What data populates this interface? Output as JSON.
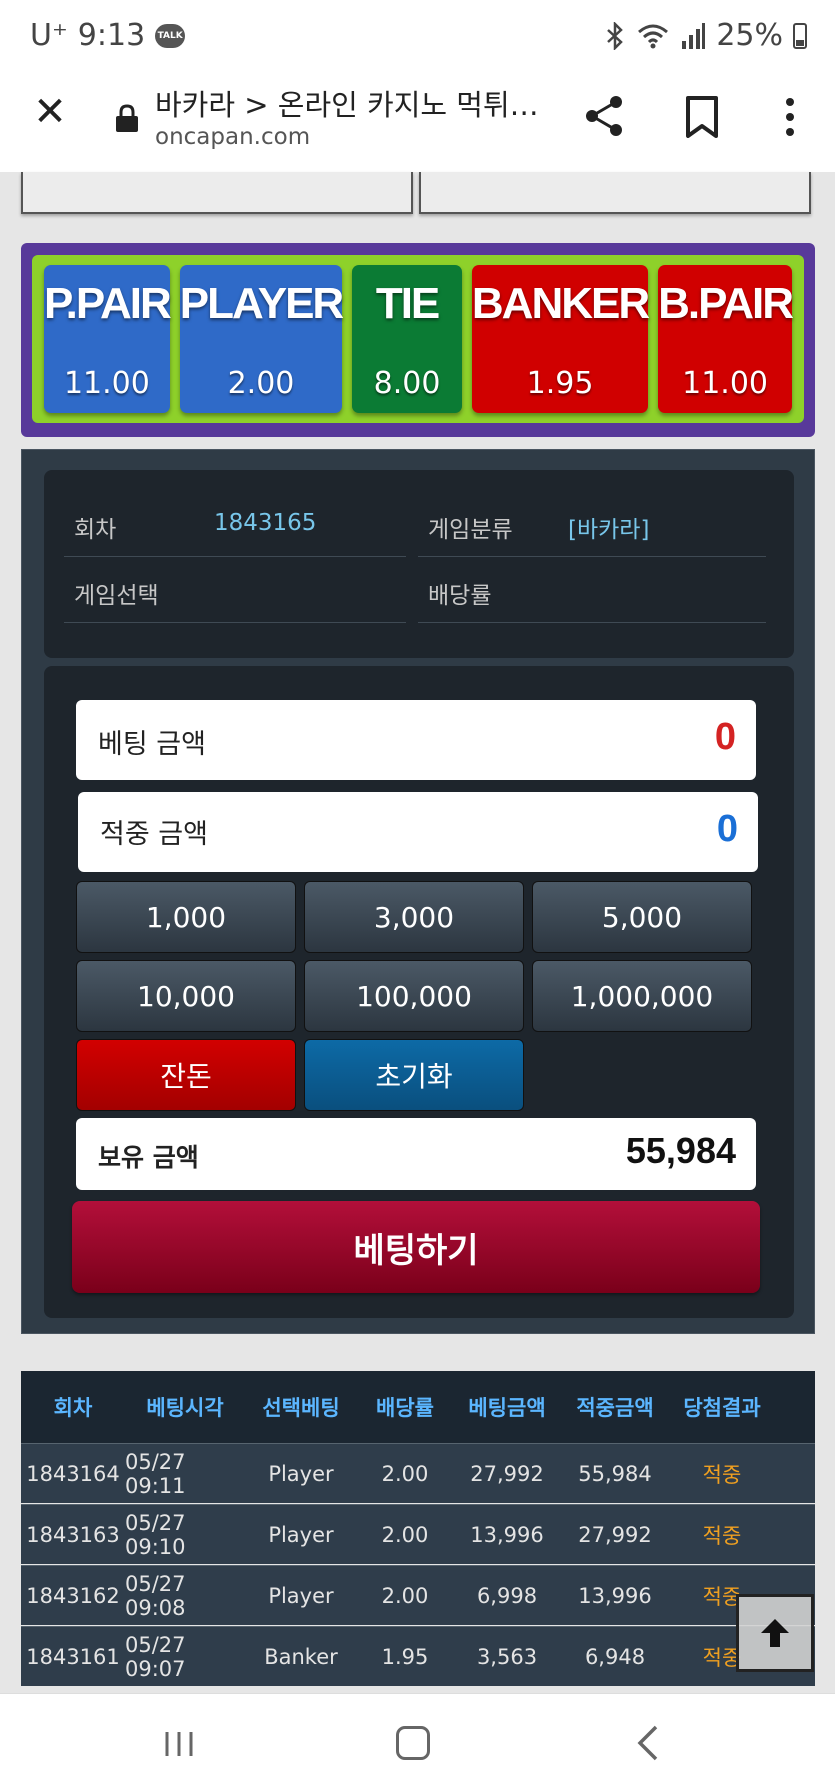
{
  "status_bar": {
    "carrier": "U⁺",
    "time": "9:13",
    "talk_badge": "TALK",
    "battery": "25%"
  },
  "browser": {
    "title": "바카라 > 온라인 카지노 먹튀…",
    "domain": "oncapan.com"
  },
  "odds": [
    {
      "name": "P.PAIR",
      "value": "11.00",
      "color": "#2f6ac8"
    },
    {
      "name": "PLAYER",
      "value": "2.00",
      "color": "#2f6ac8"
    },
    {
      "name": "TIE",
      "value": "8.00",
      "color": "#0b7b34"
    },
    {
      "name": "BANKER",
      "value": "1.95",
      "color": "#d00000"
    },
    {
      "name": "B.PAIR",
      "value": "11.00",
      "color": "#d00000"
    }
  ],
  "info": {
    "round_label": "회차",
    "round_value": "1843165",
    "category_label": "게임분류",
    "category_value": "[바카라]",
    "selection_label": "게임선택",
    "rate_label": "배당률"
  },
  "bet": {
    "bet_amount_label": "베팅 금액",
    "bet_amount_value": "0",
    "win_amount_label": "적중 금액",
    "win_amount_value": "0",
    "amount_buttons": [
      "1,000",
      "3,000",
      "5,000",
      "10,000",
      "100,000",
      "1,000,000"
    ],
    "remainder_label": "잔돈",
    "reset_label": "초기화",
    "balance_label": "보유 금액",
    "balance_value": "55,984",
    "submit_label": "베팅하기"
  },
  "history": {
    "headers": [
      "회차",
      "베팅시각",
      "선택베팅",
      "배당률",
      "베팅금액",
      "적중금액",
      "당첨결과"
    ],
    "rows": [
      [
        "1843164",
        "05/27 09:11",
        "Player",
        "2.00",
        "27,992",
        "55,984",
        "적중"
      ],
      [
        "1843163",
        "05/27 09:10",
        "Player",
        "2.00",
        "13,996",
        "27,992",
        "적중"
      ],
      [
        "1843162",
        "05/27 09:08",
        "Player",
        "2.00",
        "6,998",
        "13,996",
        "적중"
      ],
      [
        "1843161",
        "05/27 09:07",
        "Banker",
        "1.95",
        "3,563",
        "6,948",
        "적중"
      ]
    ]
  },
  "colors": {
    "accent_red": "#d42323",
    "accent_blue": "#1a6fd6",
    "result": "#f0a020"
  }
}
